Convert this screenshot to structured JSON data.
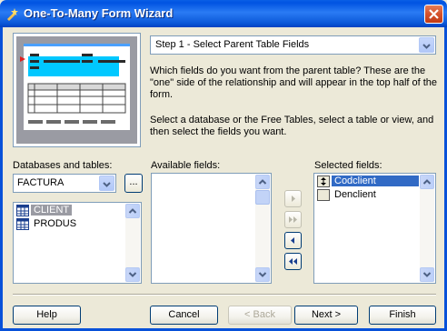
{
  "window": {
    "title": "One-To-Many Form Wizard"
  },
  "step_selector": {
    "value": "Step 1 - Select Parent Table Fields"
  },
  "description": {
    "paragraph1": "Which fields do you want from the parent table? These are the \"one\" side of the relationship and will appear in the top half of the form.",
    "paragraph2": "Select a database or the Free Tables, select a table or view, and then select the fields you want."
  },
  "databases": {
    "label": "Databases and tables:",
    "selected": "FACTURA",
    "browse_label": "...",
    "tables": [
      "CLIENT",
      "PRODUS"
    ]
  },
  "available": {
    "label": "Available fields:",
    "items": []
  },
  "selected_fields": {
    "label": "Selected fields:",
    "items": [
      "Codclient",
      "Denclient"
    ]
  },
  "buttons": {
    "help": "Help",
    "cancel": "Cancel",
    "back": "< Back",
    "next": "Next >",
    "finish": "Finish"
  },
  "colors": {
    "title_bar": "#0053e1",
    "selection": "#316ac5",
    "dialog": "#ece9d8"
  }
}
